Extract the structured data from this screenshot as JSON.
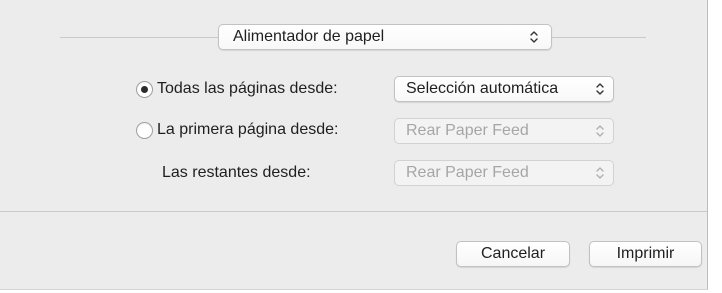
{
  "source_popup": {
    "value": "Alimentador de papel",
    "icon": "updown-chevron-icon"
  },
  "options": {
    "all_pages": {
      "label": "Todas las páginas desde:",
      "selected": true,
      "value": "Selección automática",
      "enabled": true
    },
    "first_page": {
      "label": "La primera página desde:",
      "selected": false,
      "value": "Rear Paper Feed",
      "enabled": false
    },
    "remaining": {
      "label": "Las restantes desde:",
      "value": "Rear Paper Feed",
      "enabled": false
    }
  },
  "buttons": {
    "cancel": "Cancelar",
    "print": "Imprimir"
  },
  "colors": {
    "panel_background": "#ececec",
    "disabled_text": "#a6a6a6"
  }
}
